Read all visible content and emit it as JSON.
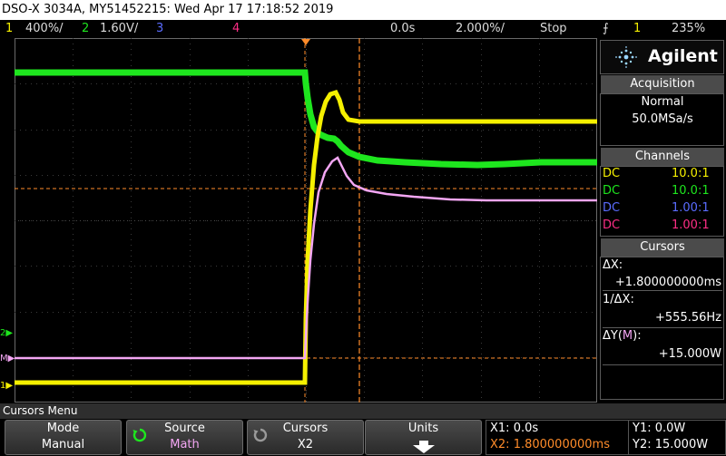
{
  "title_bar": "DSO-X 3034A, MY51452215: Wed Apr 17 17:18:52 2019",
  "status": {
    "ch1_num": "1",
    "ch1_scale": "400%/",
    "ch2_num": "2",
    "ch2_scale": "1.60V/",
    "ch3_num": "3",
    "ch4_num": "4",
    "time_delay": "0.0s",
    "time_scale": "2.000%/",
    "run_state": "Stop",
    "trigger_level": "235%"
  },
  "brand": "Agilent",
  "acquisition": {
    "header": "Acquisition",
    "mode": "Normal",
    "rate": "50.0MSa/s"
  },
  "channels": {
    "header": "Channels",
    "rows": [
      {
        "coupling": "DC",
        "probe": "10.0:1"
      },
      {
        "coupling": "DC",
        "probe": "10.0:1"
      },
      {
        "coupling": "DC",
        "probe": "1.00:1"
      },
      {
        "coupling": "DC",
        "probe": "1.00:1"
      }
    ]
  },
  "cursors_panel": {
    "header": "Cursors",
    "dx_label": "ΔX:",
    "dx_value": "+1.800000000ms",
    "inv_dx_label": "1/ΔX:",
    "inv_dx_value": "+555.56Hz",
    "dy_label_pre": "ΔY(",
    "dy_label_m": "M",
    "dy_label_post": "):",
    "dy_value": "+15.000W"
  },
  "menu_title": "Cursors Menu",
  "softkeys": {
    "mode_label": "Mode",
    "mode_value": "Manual",
    "source_label": "Source",
    "source_value": "Math",
    "cursors_label": "Cursors",
    "cursors_value": "X2",
    "units_label": "Units"
  },
  "readouts": {
    "x1": "X1: 0.0s",
    "x2": "X2: 1.800000000ms",
    "y1": "Y1: 0.0W",
    "y2": "Y2: 15.000W"
  },
  "markers": {
    "m": "M",
    "ch1": "1",
    "ch2": "2"
  },
  "colors": {
    "ch1": "#f5f000",
    "ch2": "#1ee61e",
    "ch3": "#5a6cff",
    "ch4": "#ff2e86",
    "math": "#f3a6f3",
    "cursor": "#ff8c2a",
    "accent": "#9ad6ff"
  }
}
